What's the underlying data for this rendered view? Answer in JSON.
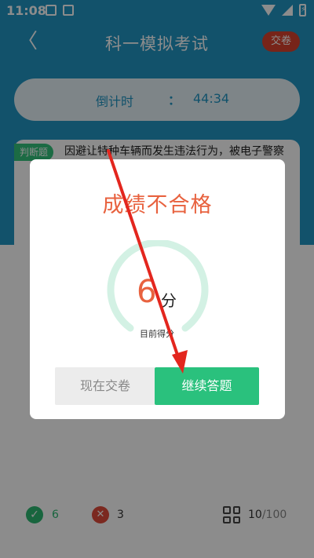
{
  "status_bar": {
    "time": "11:08",
    "battery": "⚡"
  },
  "header": {
    "title": "科一模拟考试",
    "submit_label": "交卷",
    "back_glyph": "〈"
  },
  "countdown": {
    "label": "倒计时",
    "separator": "：",
    "value": "44:34"
  },
  "question": {
    "tag": "判断题",
    "text": "因避让特种车辆而发生违法行为，被电子警察"
  },
  "dialog": {
    "title": "成绩不合格",
    "score": "6",
    "score_unit": "分",
    "score_label": "目前得分",
    "submit_now_label": "现在交卷",
    "continue_label": "继续答题"
  },
  "bottom_bar": {
    "correct_count": "6",
    "wrong_count": "3",
    "progress_current": "10",
    "progress_total": "/100",
    "correct_glyph": "✓",
    "wrong_glyph": "✕"
  },
  "colors": {
    "primary": "#2196c4",
    "fail": "#e8623f",
    "success": "#2ac17d",
    "arrow": "#e3261e"
  }
}
